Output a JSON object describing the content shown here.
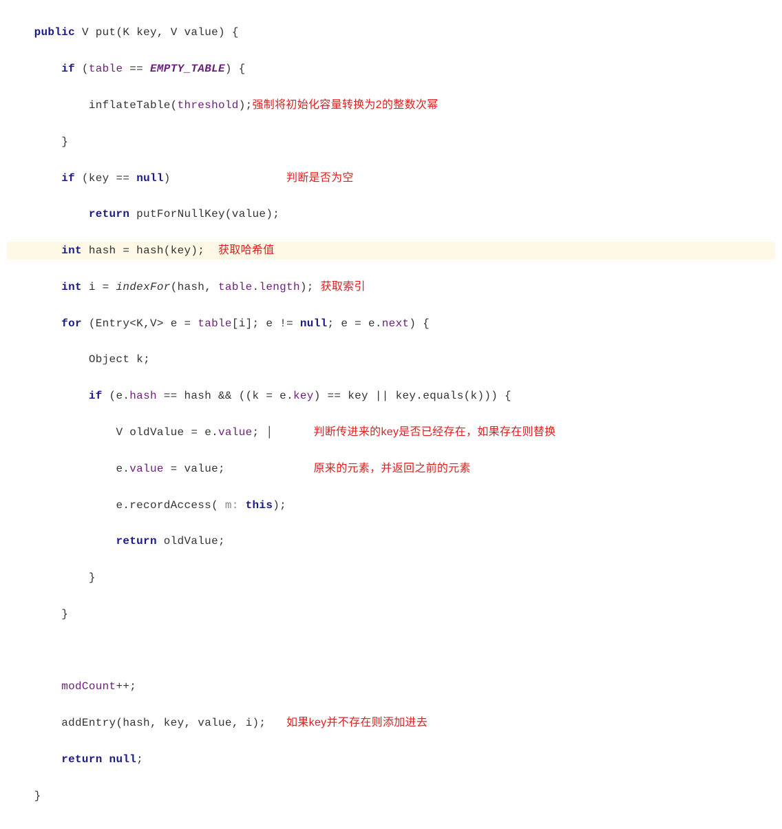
{
  "code": {
    "kw_public": "public",
    "ret_type": "V",
    "fn_put": "put",
    "param_K": "K",
    "param_key": "key",
    "param_V": "V",
    "param_value": "value",
    "kw_if": "if",
    "field_table": "table",
    "op_eqeq": "==",
    "const_empty": "EMPTY_TABLE",
    "call_inflateTable": "inflateTable",
    "field_threshold": "threshold",
    "field_key_var": "key",
    "kw_null": "null",
    "kw_return": "return",
    "call_putForNullKey": "putForNullKey",
    "var_value": "value",
    "kw_int": "int",
    "var_hash": "hash",
    "call_hash": "hash",
    "var_i": "i",
    "call_indexFor": "indexFor",
    "field_length": "length",
    "kw_for": "for",
    "type_Entry": "Entry",
    "gen_K": "K",
    "gen_V": "V",
    "var_e": "e",
    "op_ne": "!=",
    "field_next": "next",
    "type_Object": "Object",
    "var_k": "k",
    "field_hash": "hash",
    "op_and": "&&",
    "field_key": "key",
    "op_or": "||",
    "call_equals": "equals",
    "var_oldValue": "oldValue",
    "field_value": "value",
    "call_recordAccess": "recordAccess",
    "hint_m": "m:",
    "kw_this": "this",
    "field_modCount": "modCount",
    "op_pp": "++",
    "call_addEntry": "addEntry"
  },
  "annotations": {
    "a1": "强制将初始化容量转换为2的整数次幂",
    "a2": "判断是否为空",
    "a3": "获取哈希值",
    "a4": "获取索引",
    "a5a": "判断传进来的key是否已经存在，如果存在则替换",
    "a5b": "原来的元素，并返回之前的元素",
    "a6": "如果key并不存在则添加进去"
  }
}
